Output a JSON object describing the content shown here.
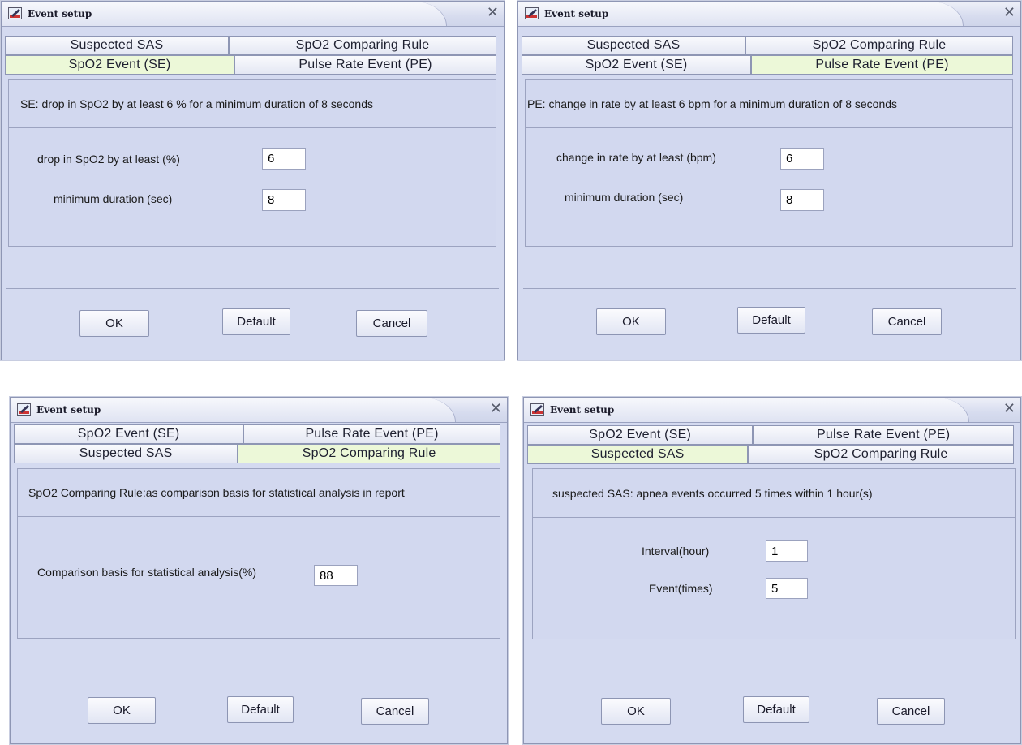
{
  "dialogs": [
    {
      "title": "Event setup",
      "tabs_row1": [
        "Suspected SAS",
        "SpO2 Comparing Rule"
      ],
      "tabs_row2": [
        "SpO2 Event (SE)",
        "Pulse Rate Event (PE)"
      ],
      "active_tab": "SpO2 Event (SE)",
      "description": "SE: drop in SpO2 by at least 6 % for a minimum duration of 8 seconds",
      "fields": [
        {
          "label": "drop in SpO2 by at least (%)",
          "value": "6"
        },
        {
          "label": "minimum duration (sec)",
          "value": "8"
        }
      ],
      "buttons": {
        "ok": "OK",
        "default": "Default",
        "cancel": "Cancel"
      }
    },
    {
      "title": "Event setup",
      "tabs_row1": [
        "Suspected SAS",
        "SpO2 Comparing Rule"
      ],
      "tabs_row2": [
        "SpO2 Event (SE)",
        "Pulse Rate Event (PE)"
      ],
      "active_tab": "Pulse Rate Event (PE)",
      "description": "PE: change in rate by at least 6 bpm for a minimum duration of 8 seconds",
      "fields": [
        {
          "label": "change in rate by at least (bpm)",
          "value": "6"
        },
        {
          "label": "minimum duration (sec)",
          "value": "8"
        }
      ],
      "buttons": {
        "ok": "OK",
        "default": "Default",
        "cancel": "Cancel"
      }
    },
    {
      "title": "Event setup",
      "tabs_row1": [
        "SpO2 Event (SE)",
        "Pulse Rate Event (PE)"
      ],
      "tabs_row2": [
        "Suspected SAS",
        "SpO2 Comparing Rule"
      ],
      "active_tab": "SpO2 Comparing Rule",
      "description": "SpO2 Comparing Rule:as comparison basis for statistical analysis in report",
      "fields": [
        {
          "label": "Comparison basis for statistical analysis(%)",
          "value": "88"
        }
      ],
      "buttons": {
        "ok": "OK",
        "default": "Default",
        "cancel": "Cancel"
      }
    },
    {
      "title": "Event setup",
      "tabs_row1": [
        "SpO2 Event (SE)",
        "Pulse Rate Event (PE)"
      ],
      "tabs_row2": [
        "Suspected SAS",
        "SpO2 Comparing Rule"
      ],
      "active_tab": "Suspected SAS",
      "description": "suspected SAS: apnea events occurred 5 times within 1 hour(s)",
      "fields": [
        {
          "label": "Interval(hour)",
          "value": "1"
        },
        {
          "label": "Event(times)",
          "value": "5"
        }
      ],
      "buttons": {
        "ok": "OK",
        "default": "Default",
        "cancel": "Cancel"
      }
    }
  ],
  "colors": {
    "dialog_bg": "#d4daf0",
    "active_tab_bg": "#ecf8d8",
    "border": "#8e96b4"
  },
  "icons": {
    "title": "edit-pencil-icon",
    "close": "close-icon"
  },
  "close_glyph": "✕"
}
